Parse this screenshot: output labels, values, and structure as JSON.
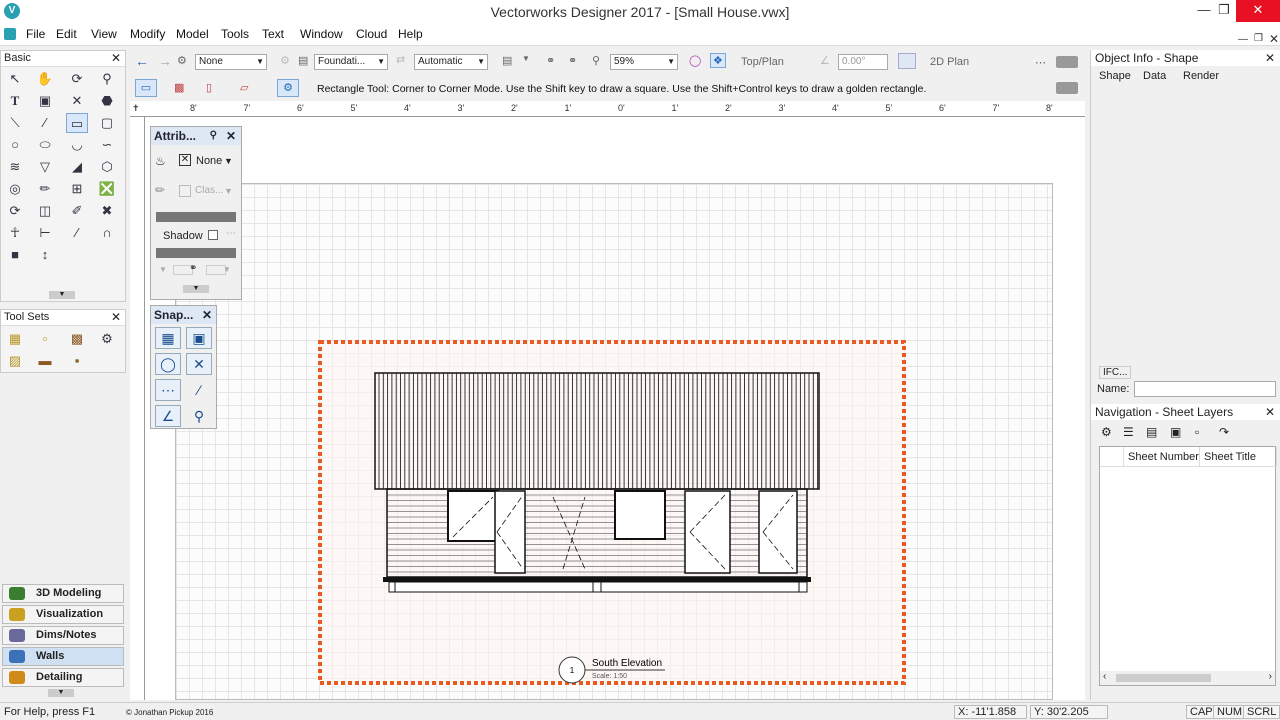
{
  "window": {
    "title": "Vectorworks Designer 2017 - [Small House.vwx]",
    "app_icon": "V"
  },
  "menu": [
    "File",
    "Edit",
    "View",
    "Modify",
    "Model",
    "Tools",
    "Text",
    "Window",
    "Cloud",
    "Help"
  ],
  "view_bar": {
    "class_value": "None",
    "layer_value": "Foundati...",
    "render_mode": "Automatic",
    "zoom": "59%",
    "view": "Top/Plan",
    "angle": "0.00°",
    "plane": "2D Plan"
  },
  "mode_bar": {
    "help_text": "Rectangle Tool: Corner to Corner Mode. Use the Shift key to draw a square. Use the Shift+Control keys to draw a golden rectangle."
  },
  "ruler_top_labels": [
    "8'",
    "7'",
    "6'",
    "5'",
    "4'",
    "3'",
    "2'",
    "1'",
    "0'",
    "1'",
    "2'",
    "3'",
    "4'",
    "5'",
    "6'",
    "7'",
    "8'"
  ],
  "basic_palette": {
    "title": "Basic"
  },
  "tool_sets_palette": {
    "title": "Tool Sets"
  },
  "toolset_buttons": [
    {
      "label": "3D Modeling",
      "color": "#3a7d2f"
    },
    {
      "label": "Visualization",
      "color": "#c9a020"
    },
    {
      "label": "Dims/Notes",
      "color": "#6a6a9a"
    },
    {
      "label": "Walls",
      "color": "#3c70b8"
    },
    {
      "label": "Detailing",
      "color": "#d08a1a"
    }
  ],
  "attributes_palette": {
    "title": "Attrib...",
    "fill_value": "None",
    "pen_class": "Clas...",
    "shadow_label": "Shadow"
  },
  "snapping_palette": {
    "title": "Snap..."
  },
  "drawing": {
    "elevation_number": "1",
    "elevation_title": "South Elevation",
    "elevation_scale": "Scale: 1:50"
  },
  "object_info": {
    "title": "Object Info - Shape",
    "tabs": [
      "Shape",
      "Data",
      "Render"
    ],
    "ifc_label": "IFC...",
    "name_label": "Name:"
  },
  "navigation": {
    "title": "Navigation - Sheet Layers",
    "columns": [
      "Sheet Number",
      "Sheet Title"
    ]
  },
  "status": {
    "help": "For Help, press F1",
    "copyright": "© Jonathan Pickup 2016",
    "x_coord": "X: -11'1.858",
    "y_coord": "Y: 30'2.205",
    "indicators": [
      "CAP",
      "NUM",
      "SCRL"
    ]
  }
}
